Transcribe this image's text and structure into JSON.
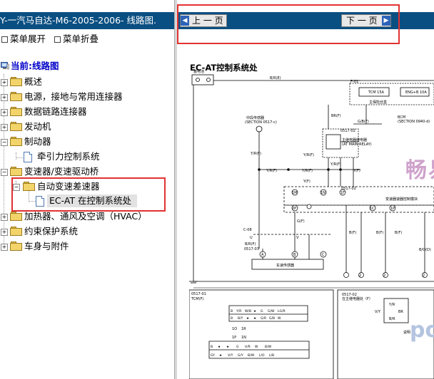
{
  "left_pane": {
    "title": "Y-一汽马自达-M6-2005-2006- 线路图.",
    "menu": {
      "expand": "菜单展开",
      "collapse": "菜单折叠"
    },
    "root_label": "当前:线路图",
    "tree": [
      {
        "label": "概述",
        "expander": "+"
      },
      {
        "label": "电源，接地与常用连接器",
        "expander": "+"
      },
      {
        "label": "数据链路连接器",
        "expander": "+"
      },
      {
        "label": "发动机",
        "expander": "+"
      },
      {
        "label": "制动器",
        "expander": "−"
      },
      {
        "label": "牵引力控制系统",
        "expander": ""
      },
      {
        "label": "变速器/变速驱动桥",
        "expander": "−"
      },
      {
        "label": "自动变速差速器",
        "expander": "−"
      },
      {
        "label": "EC-AT 在控制系统处",
        "expander": ""
      },
      {
        "label": "加热器、通风及空调（HVAC）",
        "expander": "+"
      },
      {
        "label": "约束保护系统",
        "expander": "+"
      },
      {
        "label": "车身与附件",
        "expander": "+"
      }
    ]
  },
  "right_pane": {
    "prev_button": "上 一 页",
    "next_button": "下 一 页",
    "diagram": {
      "title": "EC-AT控制系统处",
      "battery_label": "蓄电池",
      "f01": "F-01",
      "main_fuse": "主保险丝盒",
      "br_r": "B/R(E)",
      "tcm_fuse": "TCM 15A",
      "eng_fuse": "ENG+B 10A",
      "speed_sensor": "中段传感器",
      "speed_sensor_section": "(SECTION 0517-c)",
      "gb": "G/B(F)",
      "bcm": "BCM",
      "bcm_section": "(SECTION 0940-d)",
      "relay_title": "主继电器继电器",
      "relay_sub": "(AT MAIN RELAY)",
      "ref_0517_02": "0517-02",
      "ref_0517_03": "0517-03",
      "ref_0517_01": "0517-01",
      "tcm_box": "变速器速器控制模块",
      "sensor_box": "车速传感器",
      "c08": "C-08",
      "tcm_f": "TCM(F)",
      "relay_map_title": "在主继电器处（F）",
      "relay_note": "说明",
      "wire_yr": "Y/R(F)",
      "wire_br": "BR(F)",
      "wire_yf": "Y(F)",
      "wire_bf": "B(F)",
      "wire_gf": "G(F)",
      "wire_bod": "B/O(D)",
      "wire_br2": "B/R(F)",
      "pins": [
        "1M",
        "1N",
        "1F",
        "2P",
        "1C",
        "1P"
      ],
      "conn_ab": [
        "A",
        "B",
        "C"
      ],
      "conn_u": "U",
      "conn_v": "V",
      "grid_top": [
        "B",
        "Y/R",
        "W/B",
        "★",
        "G",
        "G/W",
        "LG/R",
        "B",
        "B/Y",
        "★",
        "★",
        "G/R",
        "G/B",
        "W"
      ],
      "grid_bottom": [
        "B",
        "★",
        "★",
        "G",
        "V/R",
        "W",
        "B/W",
        "GY",
        "★",
        "V/Y",
        "G/Y",
        "B/W",
        "L/O",
        "L/B"
      ],
      "small_grid": [
        "Y/R",
        "V/Y",
        "BR",
        "B/R"
      ],
      "tail_digits": [
        "2",
        "2",
        "2"
      ],
      "misc": [
        "1O",
        "1R",
        "1P",
        "1N"
      ]
    },
    "watermark_cn": "畅易",
    "watermark_en": "pong"
  },
  "colors": {
    "titlebar_bg": "#0a4f82",
    "highlight_red": "#e23232",
    "root_blue": "#0000c8",
    "folder_yellow": "#f2d46b"
  }
}
